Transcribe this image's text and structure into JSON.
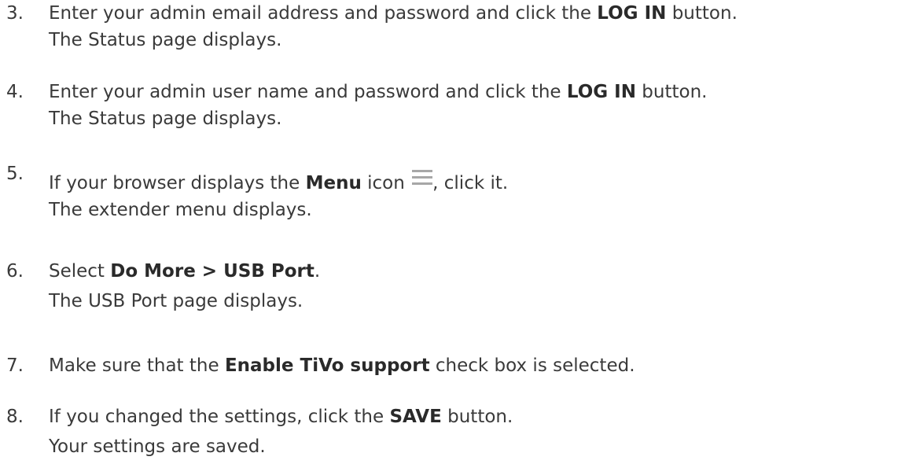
{
  "steps": [
    {
      "number": "3.",
      "line1": {
        "before": "Enter your admin email address and password and click the ",
        "bold": "LOG IN",
        "after": " button."
      },
      "line2": "The Status page displays."
    },
    {
      "number": "4.",
      "line1": {
        "before": "Enter your admin user name and password and click the ",
        "bold": "LOG IN",
        "after": " button."
      },
      "line2": "The Status page displays."
    },
    {
      "number": "5.",
      "line1": {
        "before": "If your browser displays the ",
        "bold": "Menu",
        "middle": " icon ",
        "after": ", click it."
      },
      "icon": "menu-icon",
      "line2": "The extender menu displays."
    },
    {
      "number": "6.",
      "line1": {
        "before": "Select ",
        "bold": "Do More > USB Port",
        "after": "."
      },
      "line2": "The USB Port page displays."
    },
    {
      "number": "7.",
      "line1": {
        "before": "Make sure that the ",
        "bold": "Enable TiVo support",
        "after": " check box is selected."
      }
    },
    {
      "number": "8.",
      "line1": {
        "before": "If you changed the settings, click the ",
        "bold": "SAVE",
        "after": " button."
      },
      "line2": "Your settings are saved."
    }
  ],
  "colors": {
    "text": "#3a3a3a",
    "icon": "#a7a7a7"
  }
}
